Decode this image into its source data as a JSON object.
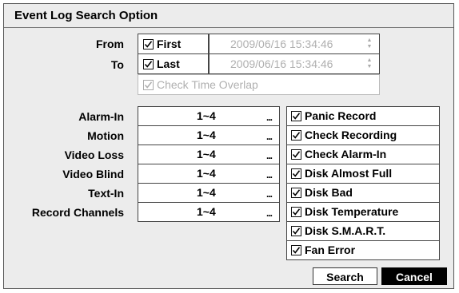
{
  "dialog": {
    "title": "Event Log Search Option"
  },
  "time": {
    "from_label": "From",
    "to_label": "To",
    "first": {
      "label": "First",
      "checked": true,
      "datetime": "2009/06/16  15:34:46"
    },
    "last": {
      "label": "Last",
      "checked": true,
      "datetime": "2009/06/16  15:34:46"
    },
    "overlap": {
      "label": "Check Time Overlap",
      "checked": true,
      "disabled": true
    }
  },
  "channels": [
    {
      "label": "Alarm-In",
      "value": "1~4",
      "more": "..."
    },
    {
      "label": "Motion",
      "value": "1~4",
      "more": "..."
    },
    {
      "label": "Video Loss",
      "value": "1~4",
      "more": "..."
    },
    {
      "label": "Video Blind",
      "value": "1~4",
      "more": "..."
    },
    {
      "label": "Text-In",
      "value": "1~4",
      "more": "..."
    },
    {
      "label": "Record Channels",
      "value": "1~4",
      "more": "..."
    }
  ],
  "system_events": [
    {
      "label": "Panic Record",
      "checked": true
    },
    {
      "label": "Check Recording",
      "checked": true
    },
    {
      "label": "Check Alarm-In",
      "checked": true
    },
    {
      "label": "Disk Almost Full",
      "checked": true
    },
    {
      "label": "Disk Bad",
      "checked": true
    },
    {
      "label": "Disk Temperature",
      "checked": true
    },
    {
      "label": "Disk S.M.A.R.T.",
      "checked": true
    },
    {
      "label": "Fan Error",
      "checked": true
    }
  ],
  "buttons": {
    "search": "Search",
    "cancel": "Cancel"
  },
  "icons": {
    "checkbox": "checkmark-icon",
    "spinner": "spinner-arrows-icon",
    "more": "ellipsis-icon"
  }
}
